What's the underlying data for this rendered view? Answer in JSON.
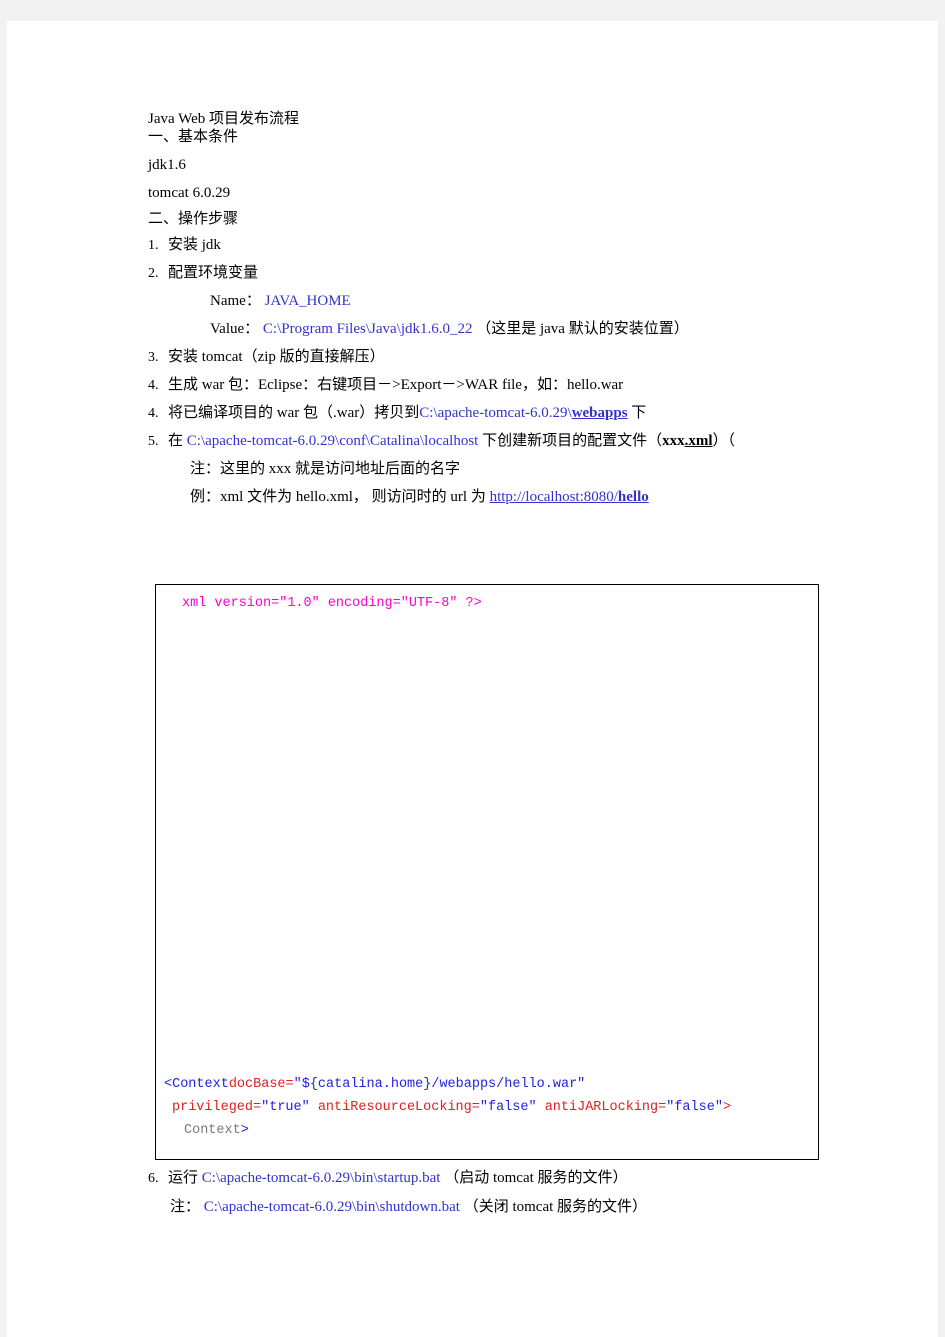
{
  "document": {
    "title": "Java Web 项目发布流程",
    "section1_heading": "一、基本条件",
    "req_jdk": "jdk1.6",
    "req_tomcat": "tomcat 6.0.29",
    "section2_heading": "二、操作步骤",
    "steps": [
      {
        "num": "1.",
        "text": "安装 jdk"
      },
      {
        "num": "2.",
        "text": "配置环境变量"
      },
      {
        "num": "3.",
        "text": "安装 tomcat（zip 版的直接解压）"
      },
      {
        "num": "4.",
        "text": "生成 war 包：Eclipse：右键项目－>Export－>WAR file，如：hello.war"
      },
      {
        "num": "4.",
        "text": "将已编译项目的 war 包（.war）拷贝到"
      },
      {
        "num": "5.",
        "text": "在"
      },
      {
        "num": "6.",
        "text": "运行"
      }
    ],
    "env_name_label": "Name：",
    "env_name_value": "JAVA_HOME",
    "env_value_label": "Value：",
    "env_value_value": "C:\\Program Files\\Java\\jdk1.6.0_22",
    "env_value_note": "（这里是 java 默认的安装位置）",
    "step5_path_prefix": "C:\\apache-tomcat-6.0.29\\",
    "step5_path_bold": "webapps",
    "step5_suffix": "下",
    "step6_path": "C:\\apache-tomcat-6.0.29\\conf\\Catalina\\localhost",
    "step6_text_mid": "下创建新项目的配置文件（",
    "step6_file_plain": "xxx",
    "step6_file_bold": ".xml",
    "step6_text_end": "）（",
    "note_label": "注：",
    "note_text": "这里的 xxx 就是访问地址后面的名字",
    "example_label": "例：",
    "example_text": "xml 文件为 hello.xml， 则访问时的 url 为",
    "example_url_plain": "http://localhost:8080/",
    "example_url_bold": "hello",
    "startup_path": "C:\\apache-tomcat-6.0.29\\bin\\startup.bat",
    "startup_note": "（启动 tomcat 服务的文件）",
    "shutdown_label": "注：",
    "shutdown_path": "C:\\apache-tomcat-6.0.29\\bin\\shutdown.bat",
    "shutdown_note": "（关闭 tomcat 服务的文件）"
  },
  "codebox": {
    "xml_declaration": "xml version=\"1.0\" encoding=\"UTF-8\" ?>",
    "line_context_open_tag": "<Context",
    "line_context_attr1": "docBase=",
    "line_context_val1": "\"${catalina.home}/webapps/hello.war\"",
    "line2_attr1": "privileged=",
    "line2_val1": "\"true\"",
    "line2_attr2": " antiResourceLocking=",
    "line2_val2": "\"false\"",
    "line2_attr3": " antiJARLocking=",
    "line2_val3": "\"false\"",
    "line2_close": ">",
    "line3_text": "Context",
    "line3_close": ">"
  },
  "colors": {
    "link_blue": "#3333cc",
    "code_magenta": "#ff00cc",
    "code_blue": "#2222dd",
    "code_red": "#e02020",
    "page_background": "#ffffff",
    "canvas_background": "#f2f2f2"
  }
}
